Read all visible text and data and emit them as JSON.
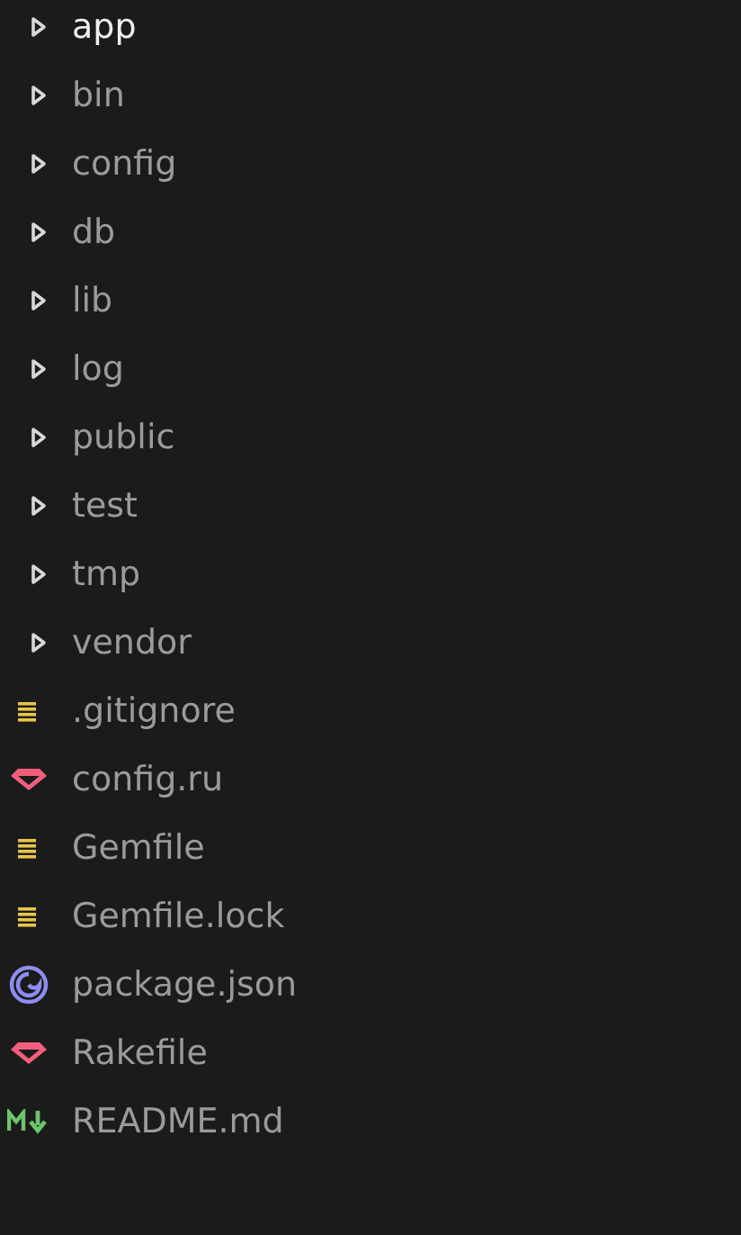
{
  "tree": [
    {
      "kind": "folder",
      "name": "app",
      "selected": true
    },
    {
      "kind": "folder",
      "name": "bin",
      "selected": false
    },
    {
      "kind": "folder",
      "name": "config",
      "selected": false
    },
    {
      "kind": "folder",
      "name": "db",
      "selected": false
    },
    {
      "kind": "folder",
      "name": "lib",
      "selected": false
    },
    {
      "kind": "folder",
      "name": "log",
      "selected": false
    },
    {
      "kind": "folder",
      "name": "public",
      "selected": false
    },
    {
      "kind": "folder",
      "name": "test",
      "selected": false
    },
    {
      "kind": "folder",
      "name": "tmp",
      "selected": false
    },
    {
      "kind": "folder",
      "name": "vendor",
      "selected": false
    },
    {
      "kind": "text",
      "name": ".gitignore",
      "selected": false
    },
    {
      "kind": "ruby",
      "name": "config.ru",
      "selected": false
    },
    {
      "kind": "text",
      "name": "Gemfile",
      "selected": false
    },
    {
      "kind": "text",
      "name": "Gemfile.lock",
      "selected": false
    },
    {
      "kind": "npm",
      "name": "package.json",
      "selected": false
    },
    {
      "kind": "ruby",
      "name": "Rakefile",
      "selected": false
    },
    {
      "kind": "markdown",
      "name": "README.md",
      "selected": false
    }
  ]
}
